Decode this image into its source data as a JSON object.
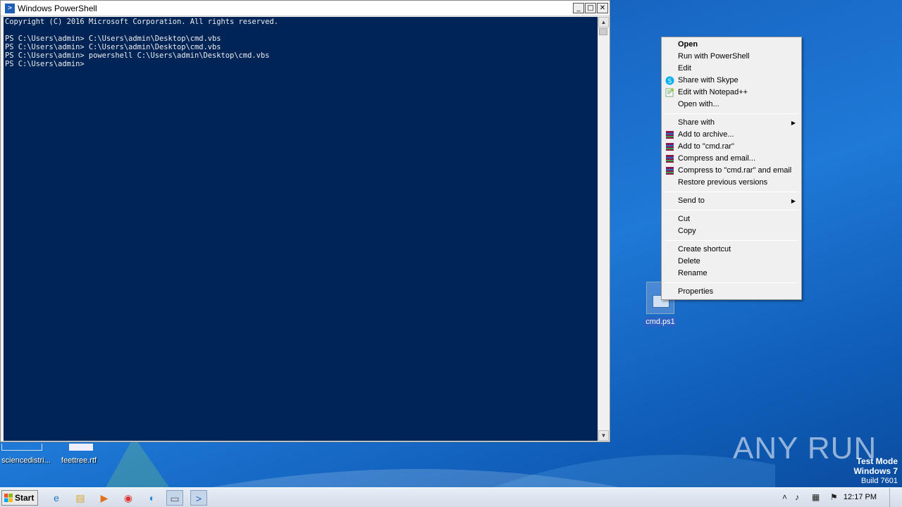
{
  "powershell": {
    "title": "Windows PowerShell",
    "lines": [
      "Copyright (C) 2016 Microsoft Corporation. All rights reserved.",
      "",
      "PS C:\\Users\\admin> C:\\Users\\admin\\Desktop\\cmd.vbs",
      "PS C:\\Users\\admin> C:\\Users\\admin\\Desktop\\cmd.vbs",
      "PS C:\\Users\\admin> powershell C:\\Users\\admin\\Desktop\\cmd.vbs",
      "PS C:\\Users\\admin>"
    ],
    "background": "#012456"
  },
  "context_menu": {
    "items": [
      {
        "label": "Open",
        "bold": true,
        "icon": ""
      },
      {
        "label": "Run with PowerShell",
        "icon": ""
      },
      {
        "label": "Edit",
        "icon": ""
      },
      {
        "label": "Share with Skype",
        "icon": "skype-icon"
      },
      {
        "label": "Edit with Notepad++",
        "icon": "notepadpp-icon"
      },
      {
        "label": "Open with...",
        "icon": ""
      },
      {
        "sep": true
      },
      {
        "label": "Share with",
        "icon": "",
        "submenu": true
      },
      {
        "label": "Add to archive...",
        "icon": "winrar-icon"
      },
      {
        "label": "Add to \"cmd.rar\"",
        "icon": "winrar-icon"
      },
      {
        "label": "Compress and email...",
        "icon": "winrar-icon"
      },
      {
        "label": "Compress to \"cmd.rar\" and email",
        "icon": "winrar-icon"
      },
      {
        "label": "Restore previous versions",
        "icon": ""
      },
      {
        "sep": true
      },
      {
        "label": "Send to",
        "icon": "",
        "submenu": true
      },
      {
        "sep": true
      },
      {
        "label": "Cut",
        "icon": ""
      },
      {
        "label": "Copy",
        "icon": ""
      },
      {
        "sep": true
      },
      {
        "label": "Create shortcut",
        "icon": ""
      },
      {
        "label": "Delete",
        "icon": ""
      },
      {
        "label": "Rename",
        "icon": ""
      },
      {
        "sep": true
      },
      {
        "label": "Properties",
        "icon": ""
      }
    ]
  },
  "desktop": {
    "selected_file": "cmd.ps1",
    "icon_1_label": "sciencedistri...",
    "icon_2_label": "feettree.rtf"
  },
  "watermark": {
    "text": "ANY RUN",
    "test_mode": "Test Mode",
    "os": "Windows 7",
    "build": "Build 7601"
  },
  "taskbar": {
    "start_label": "Start",
    "clock": "12:17 PM"
  }
}
